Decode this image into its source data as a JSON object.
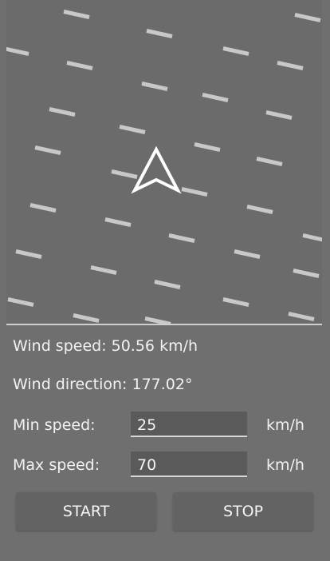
{
  "wind": {
    "speed_text": "Wind speed: 50.56 km/h",
    "direction_text": "Wind direction: 177.02°",
    "speed_kmh": 50.56,
    "direction_deg": 177.02
  },
  "controls": {
    "min_speed_label": "Min speed:",
    "min_speed_value": "25",
    "min_speed_unit": "km/h",
    "max_speed_label": "Max speed:",
    "max_speed_value": "70",
    "max_speed_unit": "km/h",
    "start_label": "START",
    "stop_label": "STOP"
  },
  "icons": {
    "direction_arrow": "navigation-arrow-icon",
    "streak": "wind-streak"
  },
  "colors": {
    "background": "#6b6b6b",
    "streak": "#c8c8c8",
    "arrow": "#ffffff",
    "text": "#f2f2f2"
  }
}
